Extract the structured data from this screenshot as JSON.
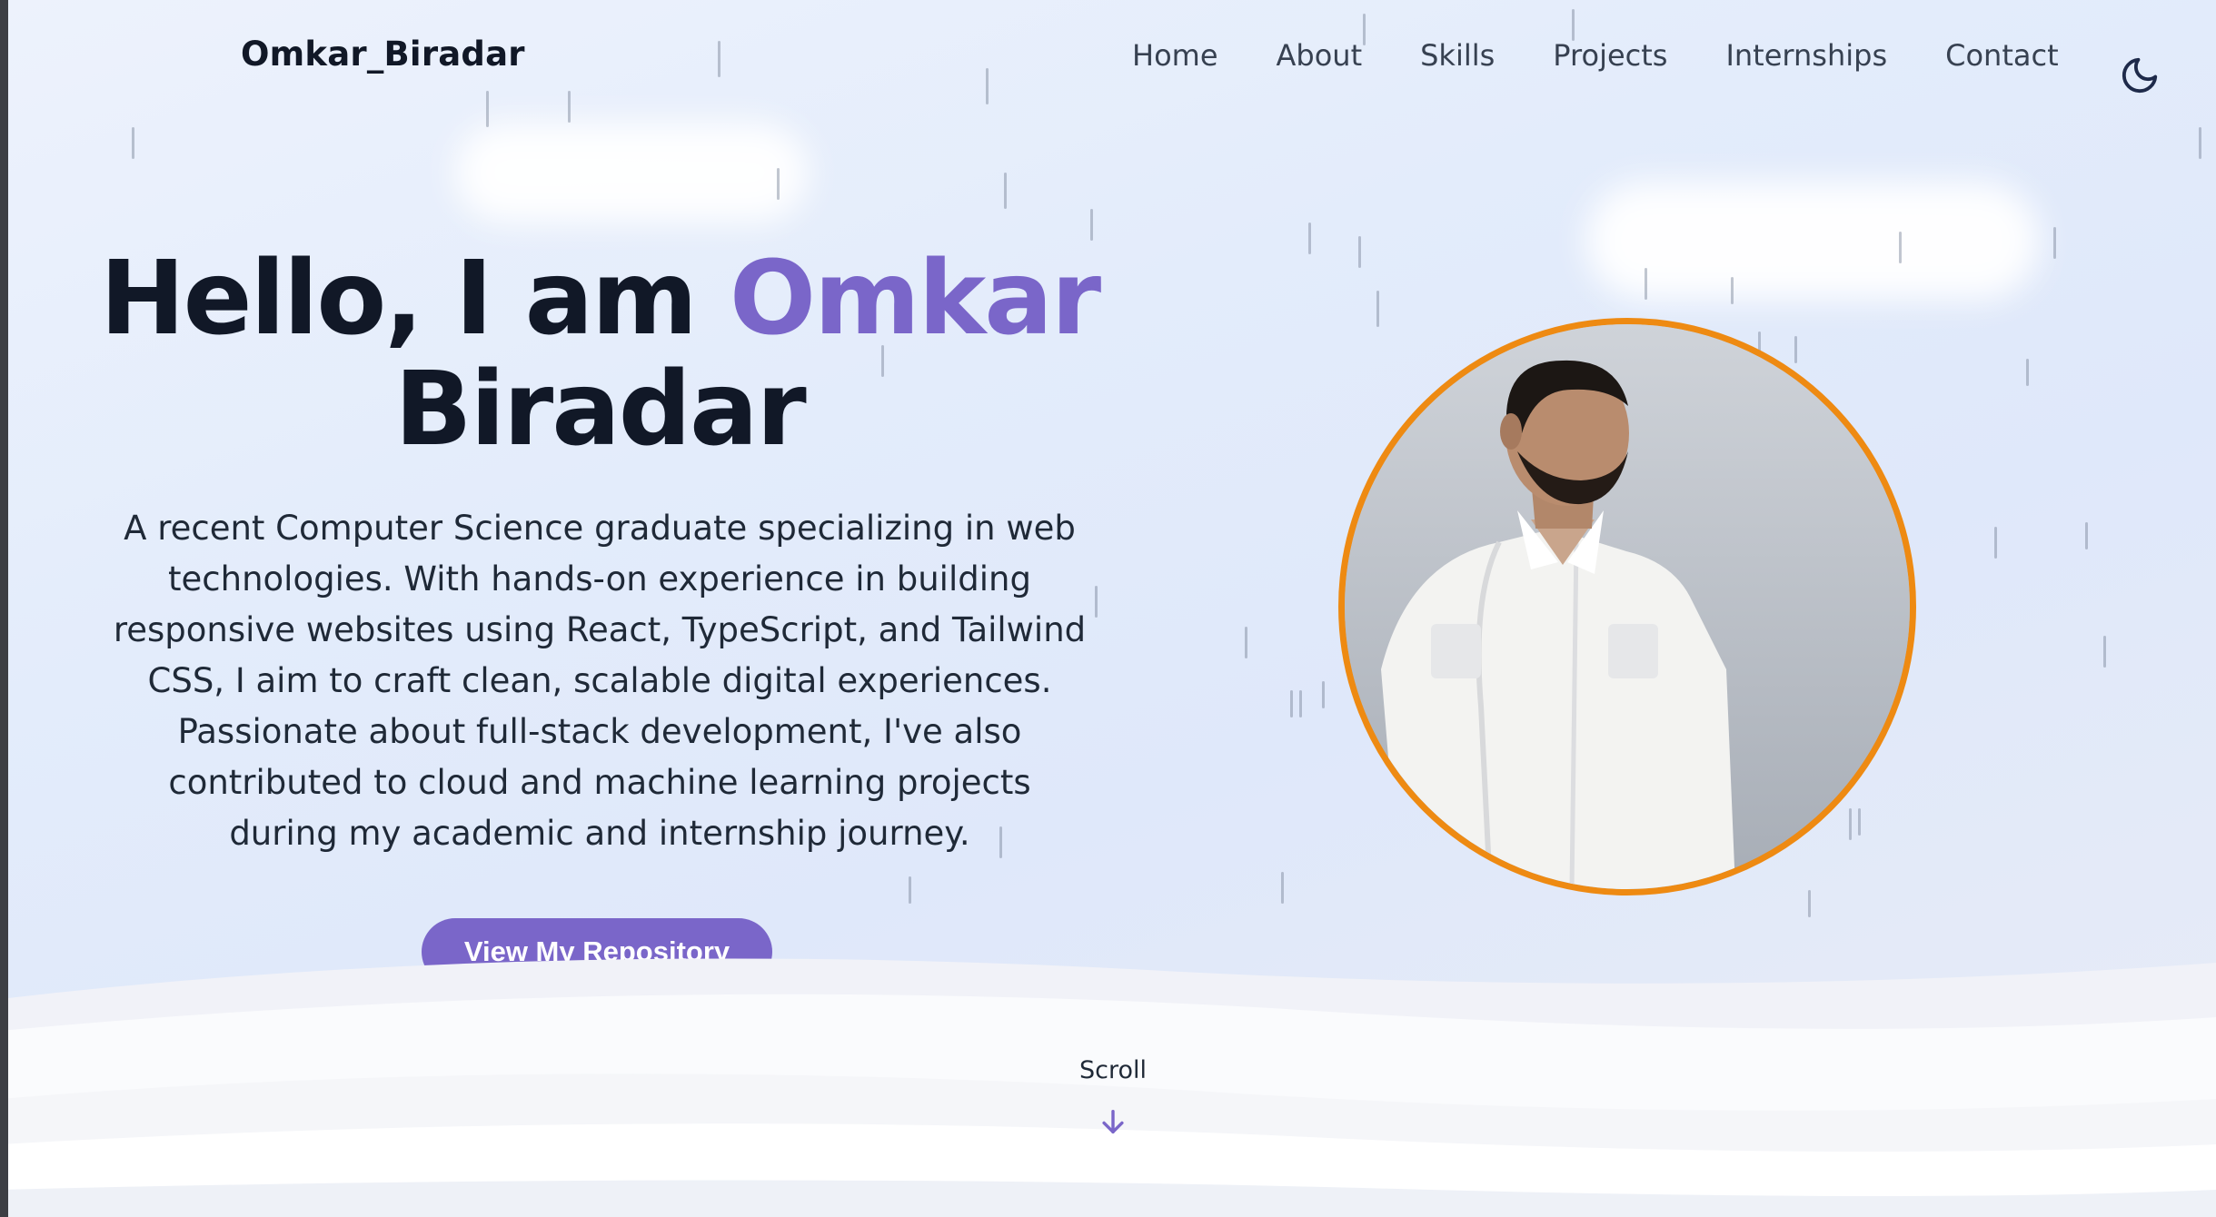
{
  "header": {
    "brand": "Omkar_Biradar",
    "nav": [
      "Home",
      "About",
      "Skills",
      "Projects",
      "Internships",
      "Contact"
    ],
    "theme_toggle_icon": "moon-icon"
  },
  "hero": {
    "title_prefix": "Hello, I am",
    "title_accent": "Omkar",
    "title_suffix": "Biradar",
    "description": "A recent Computer Science graduate specializing in web technologies. With hands-on experience in building responsive websites using React, TypeScript, and Tailwind CSS, I aim to craft clean, scalable digital experiences. Passionate about full-stack development, I've also contributed to cloud and machine learning projects during my academic and internship journey.",
    "button_label": "View My Repository",
    "portrait_icon": "profile-photo"
  },
  "scroll": {
    "label": "Scroll",
    "icon": "arrow-down-icon"
  },
  "colors": {
    "accent": "#7a66c9",
    "portrait_border": "#ee8a12",
    "text_dark": "#111827"
  }
}
